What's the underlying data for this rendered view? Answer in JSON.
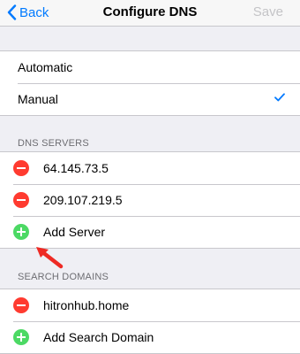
{
  "nav": {
    "back_label": "Back",
    "title": "Configure DNS",
    "save_label": "Save"
  },
  "mode": {
    "options": [
      {
        "label": "Automatic",
        "selected": false
      },
      {
        "label": "Manual",
        "selected": true
      }
    ]
  },
  "dns_servers": {
    "header": "DNS SERVERS",
    "servers": [
      "64.145.73.5",
      "209.107.219.5"
    ],
    "add_label": "Add Server"
  },
  "search_domains": {
    "header": "SEARCH DOMAINS",
    "domains": [
      "hitronhub.home"
    ],
    "add_label": "Add Search Domain"
  },
  "colors": {
    "accent": "#007aff",
    "delete": "#ff3b30",
    "add": "#4cd964",
    "arrow": "#ee2a24"
  }
}
